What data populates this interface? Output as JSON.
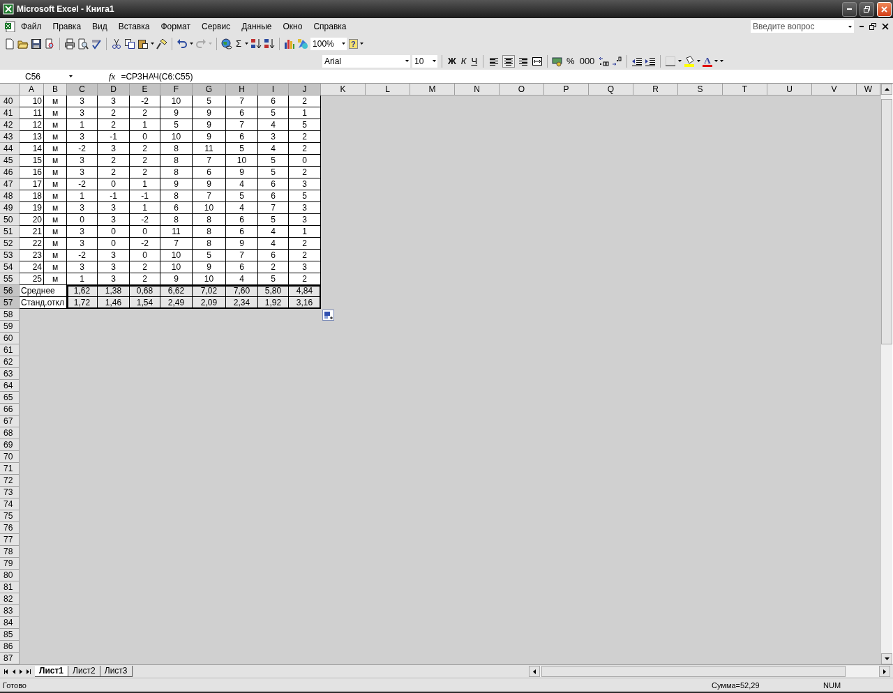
{
  "window": {
    "title": "Microsoft Excel - Книга1"
  },
  "menu": {
    "items": [
      "Файл",
      "Правка",
      "Вид",
      "Вставка",
      "Формат",
      "Сервис",
      "Данные",
      "Окно",
      "Справка"
    ],
    "help_placeholder": "Введите вопрос"
  },
  "standard_toolbar": {
    "autosum": "Σ",
    "zoom": "100%",
    "help": "?"
  },
  "formatting_toolbar": {
    "font": "Arial",
    "size": "10",
    "style_buttons": [
      "Ж",
      "К",
      "Ч"
    ],
    "alignment": [
      {
        "selected": false
      },
      {
        "selected": true
      },
      {
        "selected": false
      }
    ],
    "number_buttons": [
      "%",
      "000"
    ],
    "font_color_glyph": "A"
  },
  "formula_bar": {
    "name_box": "C56",
    "function_label": "fx",
    "formula": "=СРЗНАЧ(C6:C55)"
  },
  "sheet": {
    "columns": [
      {
        "label": "A",
        "selected": false
      },
      {
        "label": "B",
        "selected": false
      },
      {
        "label": "C",
        "selected": true
      },
      {
        "label": "D",
        "selected": true
      },
      {
        "label": "E",
        "selected": true
      },
      {
        "label": "F",
        "selected": true
      },
      {
        "label": "G",
        "selected": true
      },
      {
        "label": "H",
        "selected": true
      },
      {
        "label": "I",
        "selected": true
      },
      {
        "label": "J",
        "selected": true
      },
      {
        "label": "K",
        "selected": false
      },
      {
        "label": "L",
        "selected": false
      },
      {
        "label": "M",
        "selected": false
      },
      {
        "label": "N",
        "selected": false
      },
      {
        "label": "O",
        "selected": false
      },
      {
        "label": "P",
        "selected": false
      },
      {
        "label": "Q",
        "selected": false
      },
      {
        "label": "R",
        "selected": false
      },
      {
        "label": "S",
        "selected": false
      },
      {
        "label": "T",
        "selected": false
      },
      {
        "label": "U",
        "selected": false
      },
      {
        "label": "V",
        "selected": false
      },
      {
        "label": "W",
        "selected": false
      }
    ],
    "rows": [
      {
        "header": "40",
        "selected": false,
        "kind": "data",
        "cells": [
          "10",
          "м",
          "3",
          "3",
          "-2",
          "10",
          "5",
          "7",
          "6",
          "2"
        ]
      },
      {
        "header": "41",
        "selected": false,
        "kind": "data",
        "cells": [
          "11",
          "м",
          "3",
          "2",
          "2",
          "9",
          "9",
          "6",
          "5",
          "1"
        ]
      },
      {
        "header": "42",
        "selected": false,
        "kind": "data",
        "cells": [
          "12",
          "м",
          "1",
          "2",
          "1",
          "5",
          "9",
          "7",
          "4",
          "5"
        ]
      },
      {
        "header": "43",
        "selected": false,
        "kind": "data",
        "cells": [
          "13",
          "м",
          "3",
          "-1",
          "0",
          "10",
          "9",
          "6",
          "3",
          "2"
        ]
      },
      {
        "header": "44",
        "selected": false,
        "kind": "data",
        "cells": [
          "14",
          "м",
          "-2",
          "3",
          "2",
          "8",
          "11",
          "5",
          "4",
          "2"
        ]
      },
      {
        "header": "45",
        "selected": false,
        "kind": "data",
        "cells": [
          "15",
          "м",
          "3",
          "2",
          "2",
          "8",
          "7",
          "10",
          "5",
          "0"
        ]
      },
      {
        "header": "46",
        "selected": false,
        "kind": "data",
        "cells": [
          "16",
          "м",
          "3",
          "2",
          "2",
          "8",
          "6",
          "9",
          "5",
          "2"
        ]
      },
      {
        "header": "47",
        "selected": false,
        "kind": "data",
        "cells": [
          "17",
          "м",
          "-2",
          "0",
          "1",
          "9",
          "9",
          "4",
          "6",
          "3"
        ]
      },
      {
        "header": "48",
        "selected": false,
        "kind": "data",
        "cells": [
          "18",
          "м",
          "1",
          "-1",
          "-1",
          "8",
          "7",
          "5",
          "6",
          "5"
        ]
      },
      {
        "header": "49",
        "selected": false,
        "kind": "data",
        "cells": [
          "19",
          "м",
          "3",
          "3",
          "1",
          "6",
          "10",
          "4",
          "7",
          "3"
        ]
      },
      {
        "header": "50",
        "selected": false,
        "kind": "data",
        "cells": [
          "20",
          "м",
          "0",
          "3",
          "-2",
          "8",
          "8",
          "6",
          "5",
          "3"
        ]
      },
      {
        "header": "51",
        "selected": false,
        "kind": "data",
        "cells": [
          "21",
          "м",
          "3",
          "0",
          "0",
          "11",
          "8",
          "6",
          "4",
          "1"
        ]
      },
      {
        "header": "52",
        "selected": false,
        "kind": "data",
        "cells": [
          "22",
          "м",
          "3",
          "0",
          "-2",
          "7",
          "8",
          "9",
          "4",
          "2"
        ]
      },
      {
        "header": "53",
        "selected": false,
        "kind": "data",
        "cells": [
          "23",
          "м",
          "-2",
          "3",
          "0",
          "10",
          "5",
          "7",
          "6",
          "2"
        ]
      },
      {
        "header": "54",
        "selected": false,
        "kind": "data",
        "cells": [
          "24",
          "м",
          "3",
          "3",
          "2",
          "10",
          "9",
          "6",
          "2",
          "3"
        ]
      },
      {
        "header": "55",
        "selected": false,
        "kind": "data",
        "cells": [
          "25",
          "м",
          "1",
          "3",
          "2",
          "9",
          "10",
          "4",
          "5",
          "2"
        ]
      },
      {
        "header": "56",
        "selected": true,
        "kind": "summary",
        "label": "Среднее",
        "values": [
          "1,62",
          "1,38",
          "0,68",
          "6,62",
          "7,02",
          "7,60",
          "5,80",
          "4,84"
        ]
      },
      {
        "header": "57",
        "selected": true,
        "kind": "summary",
        "label": "Станд.откл",
        "values": [
          "1,72",
          "1,46",
          "1,54",
          "2,49",
          "2,09",
          "2,34",
          "1,92",
          "3,16"
        ]
      },
      {
        "header": "58",
        "selected": false,
        "kind": "empty"
      },
      {
        "header": "59",
        "selected": false,
        "kind": "empty"
      },
      {
        "header": "60",
        "selected": false,
        "kind": "empty"
      },
      {
        "header": "61",
        "selected": false,
        "kind": "empty"
      },
      {
        "header": "62",
        "selected": false,
        "kind": "empty"
      },
      {
        "header": "63",
        "selected": false,
        "kind": "empty"
      },
      {
        "header": "64",
        "selected": false,
        "kind": "empty"
      },
      {
        "header": "65",
        "selected": false,
        "kind": "empty"
      },
      {
        "header": "66",
        "selected": false,
        "kind": "empty"
      },
      {
        "header": "67",
        "selected": false,
        "kind": "empty"
      },
      {
        "header": "68",
        "selected": false,
        "kind": "empty"
      },
      {
        "header": "69",
        "selected": false,
        "kind": "empty"
      },
      {
        "header": "70",
        "selected": false,
        "kind": "empty"
      },
      {
        "header": "71",
        "selected": false,
        "kind": "empty"
      },
      {
        "header": "72",
        "selected": false,
        "kind": "empty"
      },
      {
        "header": "73",
        "selected": false,
        "kind": "empty"
      },
      {
        "header": "74",
        "selected": false,
        "kind": "empty"
      },
      {
        "header": "75",
        "selected": false,
        "kind": "empty"
      },
      {
        "header": "76",
        "selected": false,
        "kind": "empty"
      },
      {
        "header": "77",
        "selected": false,
        "kind": "empty"
      },
      {
        "header": "78",
        "selected": false,
        "kind": "empty"
      },
      {
        "header": "79",
        "selected": false,
        "kind": "empty"
      },
      {
        "header": "80",
        "selected": false,
        "kind": "empty"
      },
      {
        "header": "81",
        "selected": false,
        "kind": "empty"
      },
      {
        "header": "82",
        "selected": false,
        "kind": "empty"
      },
      {
        "header": "83",
        "selected": false,
        "kind": "empty"
      },
      {
        "header": "84",
        "selected": false,
        "kind": "empty"
      },
      {
        "header": "85",
        "selected": false,
        "kind": "empty"
      },
      {
        "header": "86",
        "selected": false,
        "kind": "empty"
      },
      {
        "header": "87",
        "selected": false,
        "kind": "empty"
      }
    ]
  },
  "sheet_tabs": [
    {
      "label": "Лист1",
      "selected": true
    },
    {
      "label": "Лист2",
      "selected": false
    },
    {
      "label": "Лист3",
      "selected": false
    }
  ],
  "status_bar": {
    "status": "Готово",
    "sum": "Сумма=52,29",
    "num": "NUM"
  }
}
